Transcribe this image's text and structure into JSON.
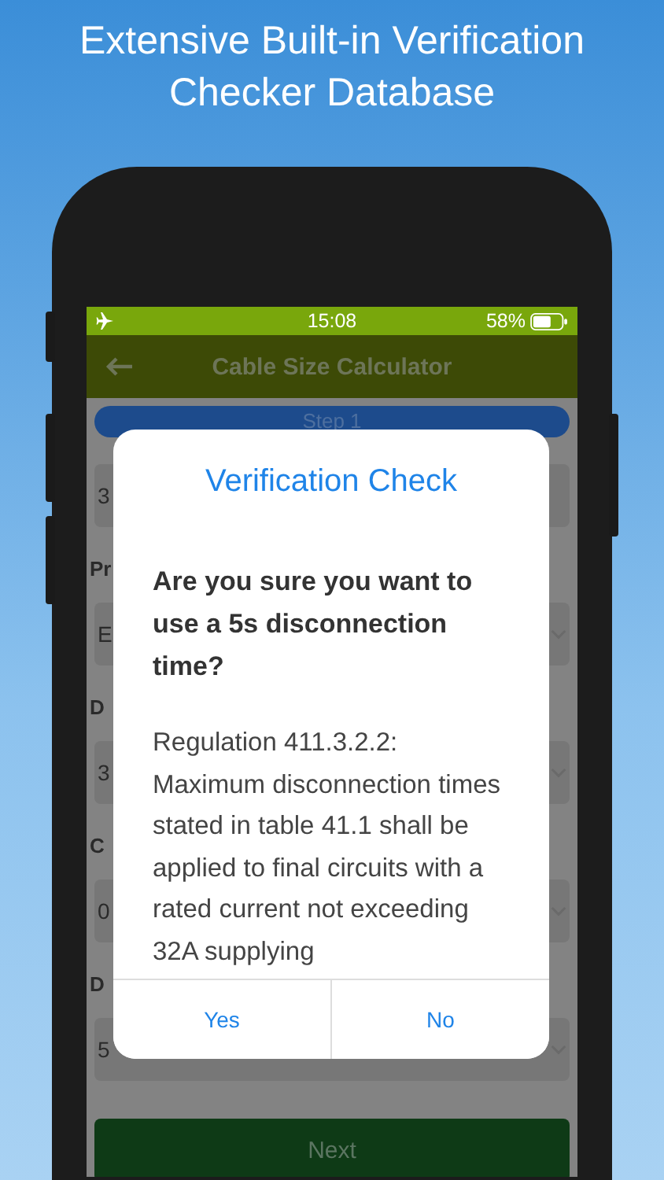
{
  "headline": "Extensive Built-in Verification Checker Database",
  "status_bar": {
    "time": "15:08",
    "battery": "58%"
  },
  "nav": {
    "title": "Cable Size Calculator"
  },
  "step": {
    "label": "Step 1"
  },
  "form": {
    "fields": [
      {
        "value": "3",
        "dropdown": false
      },
      {
        "label": "Pr",
        "value": "E",
        "dropdown": true
      },
      {
        "label": "D",
        "value": "3",
        "dropdown": true
      },
      {
        "label": "C",
        "value": "0",
        "dropdown": true
      },
      {
        "label": "D",
        "value": "5",
        "dropdown": true
      }
    ]
  },
  "next_button": "Next",
  "dialog": {
    "title": "Verification Check",
    "question": "Are you sure you want to use a 5s disconnection time?",
    "body": "Regulation 411.3.2.2: Maximum disconnection times stated in table 41.1 shall be applied to final circuits with a rated current not exceeding 32A supplying",
    "buttons": [
      "Yes",
      "No"
    ]
  }
}
